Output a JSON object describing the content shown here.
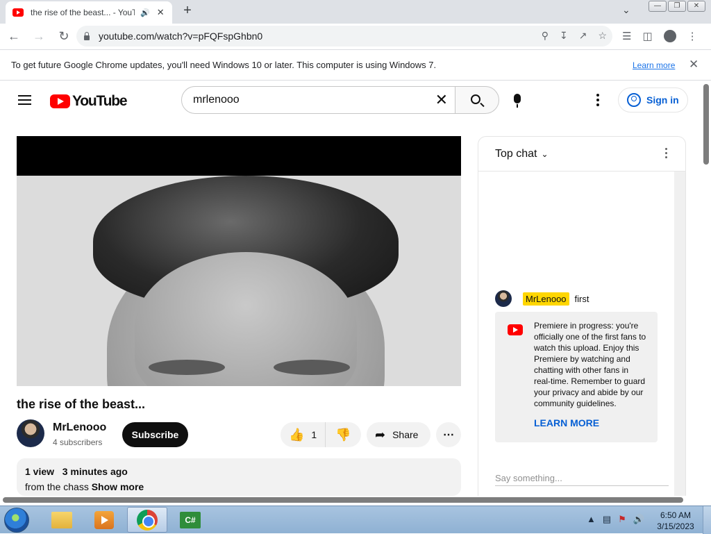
{
  "browser": {
    "tab_title": "the rise of the beast... - YouTube",
    "url": "youtube.com/watch?v=pFQFspGhbn0"
  },
  "infobar": {
    "message": "To get future Google Chrome updates, you'll need Windows 10 or later. This computer is using Windows 7.",
    "learn_more": "Learn more"
  },
  "youtube": {
    "logo_text": "YouTube",
    "search_query": "mrlenooo",
    "sign_in": "Sign in"
  },
  "video": {
    "title": "the rise of the beast...",
    "channel_name": "MrLenooo",
    "subscribers": "4 subscribers",
    "subscribe_label": "Subscribe",
    "like_count": "1",
    "share_label": "Share",
    "views": "1 view",
    "published": "3 minutes ago",
    "description": "from the chass",
    "show_more": "Show more"
  },
  "chat": {
    "header": "Top chat",
    "message": {
      "author": "MrLenooo",
      "text": "first"
    },
    "notice": "Premiere in progress: you're officially one of the first fans to watch this upload. Enjoy this Premiere by watching and chatting with other fans in real-time. Remember to guard your privacy and abide by our community guidelines.",
    "learn_more": "LEARN MORE",
    "input_placeholder": "Say something..."
  },
  "taskbar": {
    "time": "6:50 AM",
    "date": "3/15/2023"
  }
}
